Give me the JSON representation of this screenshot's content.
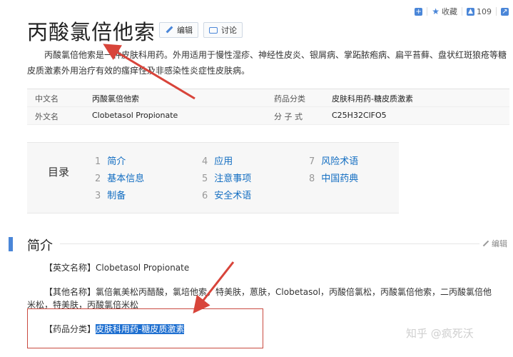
{
  "topbar": {
    "favorite_label": "收藏",
    "like_count": "109",
    "icons": [
      "plus-square-icon",
      "star-icon",
      "thumbs-up-icon",
      "share-icon"
    ]
  },
  "entry": {
    "title": "丙酸氯倍他索",
    "edit_label": "编辑",
    "discuss_label": "讨论",
    "summary": "丙酸氯倍他索是一种皮肤科用药。外用适用于慢性湿疹、神经性皮炎、银屑病、掌跖脓疱病、扁平苔藓、盘状红斑狼疮等糖皮质激素外用治疗有效的瘙痒性及非感染性炎症性皮肤病。"
  },
  "infobox": {
    "rows": [
      {
        "k1": "中文名",
        "v1": "丙酸氯倍他索",
        "k2": "药品分类",
        "v2": "皮肤科用药-糖皮质激素"
      },
      {
        "k1": "外文名",
        "v1": "Clobetasol Propionate",
        "k2": "分 子 式",
        "v2": "C25H32ClFO5"
      }
    ]
  },
  "toc": {
    "title": "目录",
    "items": [
      {
        "num": "1",
        "label": "简介"
      },
      {
        "num": "2",
        "label": "基本信息"
      },
      {
        "num": "3",
        "label": "制备"
      },
      {
        "num": "4",
        "label": "应用"
      },
      {
        "num": "5",
        "label": "注意事项"
      },
      {
        "num": "6",
        "label": "安全术语"
      },
      {
        "num": "7",
        "label": "风险术语"
      },
      {
        "num": "8",
        "label": "中国药典"
      }
    ]
  },
  "section": {
    "title": "简介",
    "edit_label": "编辑",
    "english_name_label": "【英文名称】",
    "english_name_value": "Clobetasol Propionate",
    "other_names_label": "【其他名称】",
    "other_names_value": "氯倍氟美松丙醋酸，氯培他索，特美肤，蒽肤，Clobetasol，丙酸倍氯松，丙酸氯倍他索，二丙酸氯倍他米松，特美肤，丙酸氯倍米松",
    "category_label": "【药品分类】",
    "category_value": "皮肤科用药-糖皮质激素"
  },
  "watermark": "知乎 @疯死沃",
  "colors": {
    "link": "#136ec2",
    "accent": "#4a86d8",
    "annotation": "#d8443a",
    "highlight": "#1e6fd0"
  }
}
